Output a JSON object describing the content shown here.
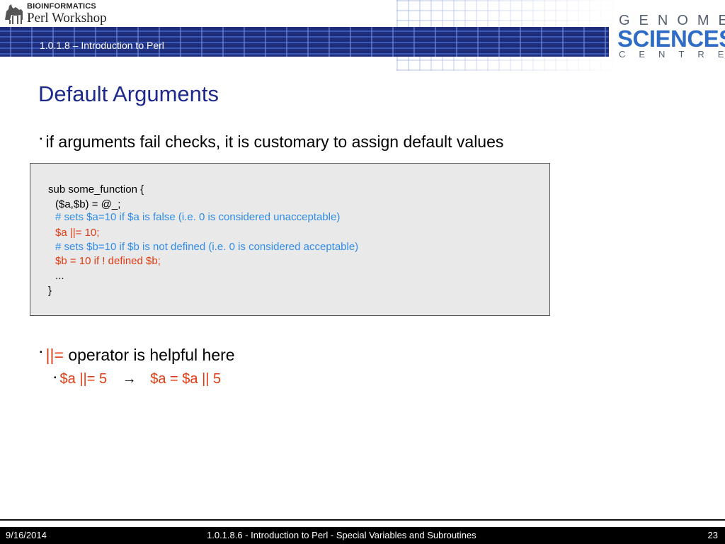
{
  "header": {
    "logo_top": "BIOINFORMATICS",
    "logo_bottom": "Perl Workshop",
    "course": "1.0.1.8 – Introduction to Perl",
    "gsc": {
      "row1": "GENOME",
      "row2": "SCIENCES",
      "row3": "CENTRE"
    }
  },
  "slide": {
    "title": "Default Arguments",
    "bullet1": "if arguments fail checks, it is customary to assign default values",
    "code": {
      "l1": "sub some_function {",
      "l2": "($a,$b) = @_;",
      "l3": "# sets $a=10 if $a is false (i.e. 0 is considered unacceptable)",
      "l4": "$a ||= 10;",
      "l5": "# sets $b=10 if $b is not defined (i.e. 0 is considered acceptable)",
      "l6": "$b = 10 if ! defined $b;",
      "l7": "...",
      "l8": "}"
    },
    "bullet2_op": "||=",
    "bullet2_rest": " operator is helpful here",
    "bullet3_left": "$a ||= 5",
    "bullet3_arrow": "→",
    "bullet3_right": "$a = $a || 5"
  },
  "footer": {
    "date": "9/16/2014",
    "title": "1.0.1.8.6 - Introduction to Perl - Special Variables and Subroutines",
    "page": "23"
  },
  "colors": {
    "title": "#1d2a8c",
    "highlight": "#e03a12",
    "comment": "#2f8ce8",
    "band": "#20307e"
  }
}
